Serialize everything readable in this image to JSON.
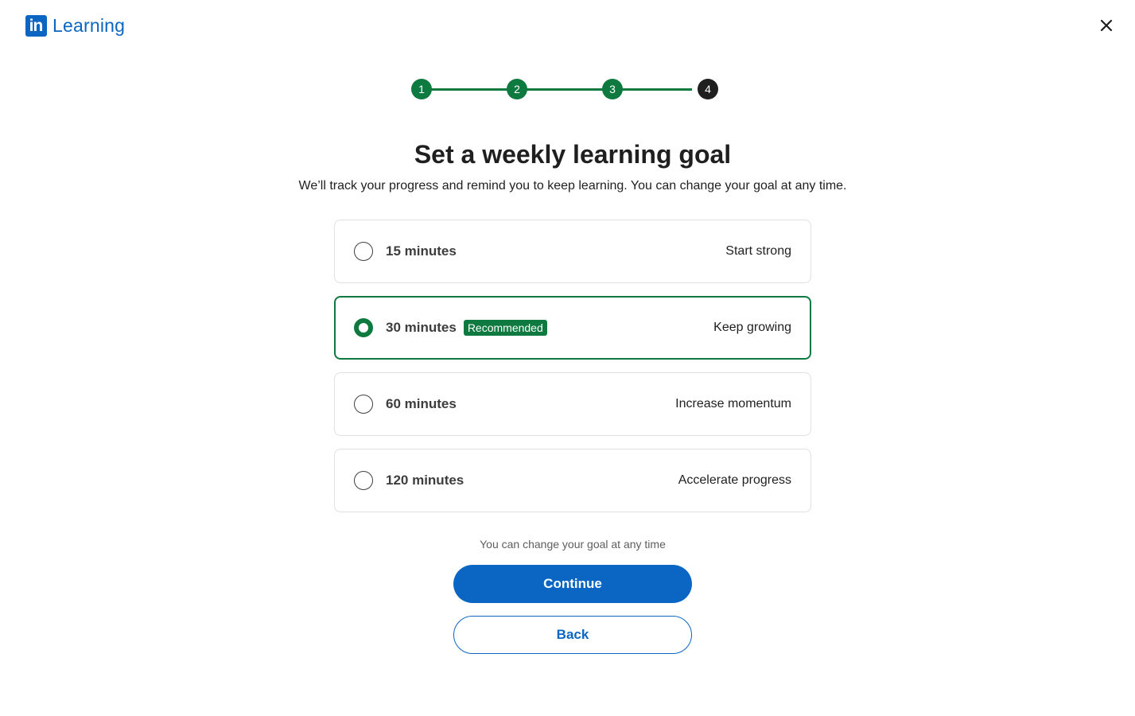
{
  "header": {
    "logo_mark": "in",
    "logo_text": "Learning",
    "close_label": "×"
  },
  "stepper": {
    "steps": [
      "1",
      "2",
      "3",
      "4"
    ],
    "current_step": 4
  },
  "title": "Set a weekly learning goal",
  "subtitle": "We’ll track your progress and remind you to keep learning. You can change your goal at any time.",
  "options": [
    {
      "label": "15 minutes",
      "badge": "",
      "description": "Start strong",
      "selected": false
    },
    {
      "label": "30 minutes",
      "badge": "Recommended",
      "description": "Keep growing",
      "selected": true
    },
    {
      "label": "60 minutes",
      "badge": "",
      "description": "Increase momentum",
      "selected": false
    },
    {
      "label": "120 minutes",
      "badge": "",
      "description": "Accelerate progress",
      "selected": false
    }
  ],
  "note": "You can change your goal at any time",
  "buttons": {
    "continue": "Continue",
    "back": "Back"
  },
  "colors": {
    "brand_blue": "#0a66c2",
    "progress_green": "#0f7a3f",
    "current_step": "#1f1f1f"
  }
}
